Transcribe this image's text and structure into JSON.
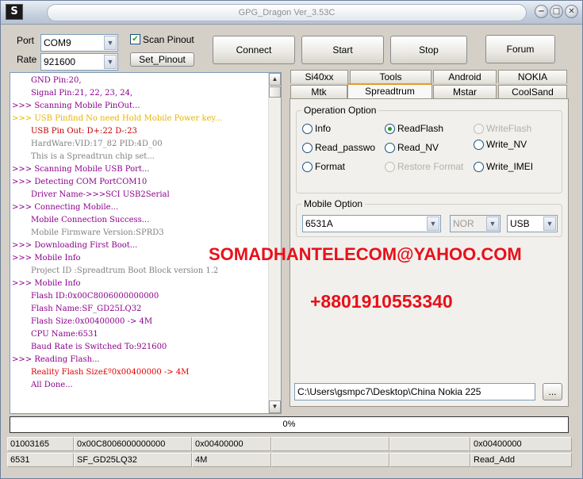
{
  "window": {
    "title": "GPG_Dragon  Ver_3.53C",
    "app_icon": "S"
  },
  "port": {
    "label": "Port",
    "value": "COM9"
  },
  "rate": {
    "label": "Rate",
    "value": "921600"
  },
  "scan_pinout": {
    "label": "Scan Pinout",
    "checked": true
  },
  "buttons": {
    "set_pinout": "Set_Pinout",
    "connect": "Connect",
    "start": "Start",
    "stop": "Stop",
    "forum": "Forum",
    "browse": "..."
  },
  "log": [
    {
      "text": "GND Pin:20,",
      "color": "#8b008b",
      "indent": 26
    },
    {
      "text": "Signal Pin:21, 22, 23, 24,",
      "color": "#8b008b",
      "indent": 26
    },
    {
      "text": ">>> Scanning Mobile PinOut...",
      "color": "#8b008b",
      "indent": 2
    },
    {
      "text": ">>> USB Pinfind No need Hold Mobile Power key...",
      "color": "#e8b400",
      "indent": 2
    },
    {
      "text": "USB Pin Out: D+:22  D-:23",
      "color": "#c00000",
      "indent": 26
    },
    {
      "text": "HardWare:VID:17_82 PID:4D_00",
      "color": "#808080",
      "indent": 26
    },
    {
      "text": "This is a Spreadtrun chip set...",
      "color": "#808080",
      "indent": 26
    },
    {
      "text": ">>> Scanning Mobile USB Port...",
      "color": "#8b008b",
      "indent": 2
    },
    {
      "text": ">>> Detecting COM PortCOM10",
      "color": "#8b008b",
      "indent": 2
    },
    {
      "text": "Driver Name->>>SCI USB2Serial",
      "color": "#8b008b",
      "indent": 26
    },
    {
      "text": ">>> Connecting Mobile...",
      "color": "#8b008b",
      "indent": 2
    },
    {
      "text": "Mobile Connection Success...",
      "color": "#8b008b",
      "indent": 26
    },
    {
      "text": "Mobile Firmware Version:SPRD3",
      "color": "#808080",
      "indent": 26
    },
    {
      "text": ">>> Downloading First Boot...",
      "color": "#8b008b",
      "indent": 2
    },
    {
      "text": ">>> Mobile Info",
      "color": "#8b008b",
      "indent": 2
    },
    {
      "text": "Project ID :Spreadtrum Boot Block version 1.2",
      "color": "#808080",
      "indent": 26
    },
    {
      "text": ">>> Mobile Info",
      "color": "#8b008b",
      "indent": 2
    },
    {
      "text": "Flash ID:0x00C8006000000000",
      "color": "#8b008b",
      "indent": 26
    },
    {
      "text": "Flash Name:SF_GD25LQ32",
      "color": "#8b008b",
      "indent": 26
    },
    {
      "text": "Flash Size:0x00400000  -> 4M",
      "color": "#8b008b",
      "indent": 26
    },
    {
      "text": "CPU Name:6531",
      "color": "#8b008b",
      "indent": 26
    },
    {
      "text": " Baud Rate is Switched To:921600",
      "color": "#8b008b",
      "indent": 26
    },
    {
      "text": ">>> Reading Flash...",
      "color": "#8b008b",
      "indent": 2
    },
    {
      "text": "Reality Flash Size£º0x00400000 -> 4M",
      "color": "#e00000",
      "indent": 26
    },
    {
      "text": "All Done...",
      "color": "#8b008b",
      "indent": 26
    }
  ],
  "tabs_row1": [
    "Si40xx",
    "Tools",
    "Android",
    "NOKIA"
  ],
  "tabs_row2": [
    "Mtk",
    "Spreadtrum",
    "Mstar",
    "CoolSand"
  ],
  "active_tab": "Spreadtrum",
  "operation": {
    "title": "Operation Option",
    "options": [
      {
        "label": "Info",
        "selected": false,
        "disabled": false
      },
      {
        "label": "ReadFlash",
        "selected": true,
        "disabled": false
      },
      {
        "label": "WriteFlash",
        "selected": false,
        "disabled": true
      },
      {
        "label": "Read_passwo",
        "selected": false,
        "disabled": false
      },
      {
        "label": "Read_NV",
        "selected": false,
        "disabled": false
      },
      {
        "label": "Write_NV",
        "selected": false,
        "disabled": false
      },
      {
        "label": "Format",
        "selected": false,
        "disabled": false
      },
      {
        "label": "Restore Format",
        "selected": false,
        "disabled": true
      },
      {
        "label": "Write_IMEI",
        "selected": false,
        "disabled": false
      }
    ]
  },
  "mobile_option": {
    "title": "Mobile Option",
    "chip": "6531A",
    "flash_type": "NOR",
    "interface": "USB"
  },
  "overlay": {
    "email": "SOMADHANTELECOM@YAHOO.COM",
    "phone": "+8801910553340"
  },
  "path": "C:\\Users\\gsmpc7\\Desktop\\China Nokia 225",
  "progress": {
    "text": "0%",
    "fraction": 0
  },
  "status_row1": [
    "01003165",
    "0x00C8006000000000",
    "0x00400000",
    "",
    "",
    "0x00400000"
  ],
  "status_row2": [
    "6531",
    "SF_GD25LQ32",
    "4M",
    "",
    "",
    "Read_Add"
  ],
  "colors": {
    "title_text": "#8a8f96",
    "overlay_red": "#e8101a",
    "tab_accent": "#e69a2a",
    "radio_dot": "#1f9d2c"
  }
}
